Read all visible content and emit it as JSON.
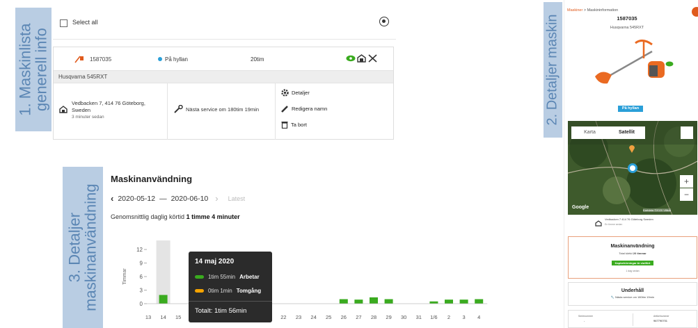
{
  "labels": {
    "section1_line1": "1. Maskinlista",
    "section1_line2": "generell info",
    "section2": "2. Detaljer maskin",
    "section3_line1": "3. Detaljer",
    "section3_line2": "maskinanvändning"
  },
  "machine_list": {
    "select_all": "Select all",
    "machine": {
      "id": "1587035",
      "status": "På hyllan",
      "hours": "20tim",
      "model": "Husqvarna 545RXT",
      "address_line1": "Vedbacken 7, 414 76 Göteborg,",
      "address_line2": "Sweden",
      "address_time": "3 minuter sedan",
      "next_service": "Nästa service om 180tim 19min",
      "actions": [
        "Detaljer",
        "Redigera namn",
        "Ta bort"
      ]
    }
  },
  "machine_detail": {
    "breadcrumb_root": "Maskiner",
    "breadcrumb_sep": ">",
    "breadcrumb_current": "Maskininformation",
    "id": "1587035",
    "model": "Husqvarna 545RXT",
    "status_badge": "På hyllan",
    "map_tabs": [
      "Karta",
      "Satellit"
    ],
    "map_zoom_in": "+",
    "map_zoom_out": "−",
    "map_brand": "Google",
    "map_footer": "Kartdata ©2020 Villkor",
    "address": "Vedbacken 7 414 76 Göteborg Sweden",
    "address_time": "En timme sedan",
    "usage_title": "Maskinanvändning",
    "usage_total_prefix": "Total körtid",
    "usage_total_value": "20 timmar",
    "usage_badge": "Kapbehörningar är slutfört",
    "usage_sub": "1 dag sedan",
    "service_title": "Underhåll",
    "service_text": "Nästa service om 180tim 19min",
    "serial_label": "Serienummer",
    "serial_value": "-",
    "article_label": "Artikelnummer",
    "article_value": "967790701"
  },
  "usage": {
    "title": "Maskinanvändning",
    "range_start": "2020-05-12",
    "range_sep": "—",
    "range_end": "2020-06-10",
    "latest": "Latest",
    "avg_prefix": "Genomsnittlig daglig körtid",
    "avg_value": "1 timme 4 minuter",
    "tooltip": {
      "date": "14 maj 2020",
      "work_value": "1tim 55min",
      "work_label": "Arbetar",
      "idle_value": "0tim 1min",
      "idle_label": "Tomgång",
      "total": "Totalt: 1tim 56min"
    }
  },
  "chart_data": {
    "type": "bar",
    "ylabel": "Timmar",
    "ylim": [
      0,
      12
    ],
    "yticks": [
      "0",
      "3",
      "6",
      "9",
      "12"
    ],
    "categories": [
      "13",
      "14",
      "15",
      "16",
      "17",
      "18",
      "19",
      "20",
      "21",
      "22",
      "23",
      "24",
      "25",
      "26",
      "27",
      "28",
      "29",
      "30",
      "31",
      "1/6",
      "2",
      "3",
      "4"
    ],
    "values": [
      0,
      1.93,
      0,
      0,
      0,
      0,
      0,
      0,
      0,
      0,
      0,
      0,
      0,
      1.0,
      0.9,
      1.4,
      1.0,
      0,
      0,
      0.5,
      0.9,
      0.9,
      1.0
    ],
    "highlight_index": 1,
    "bar_color": "#3aab1f",
    "highlight_color": "#e4e4e4",
    "work_color": "#3aab1f",
    "idle_color": "#f5a300"
  }
}
